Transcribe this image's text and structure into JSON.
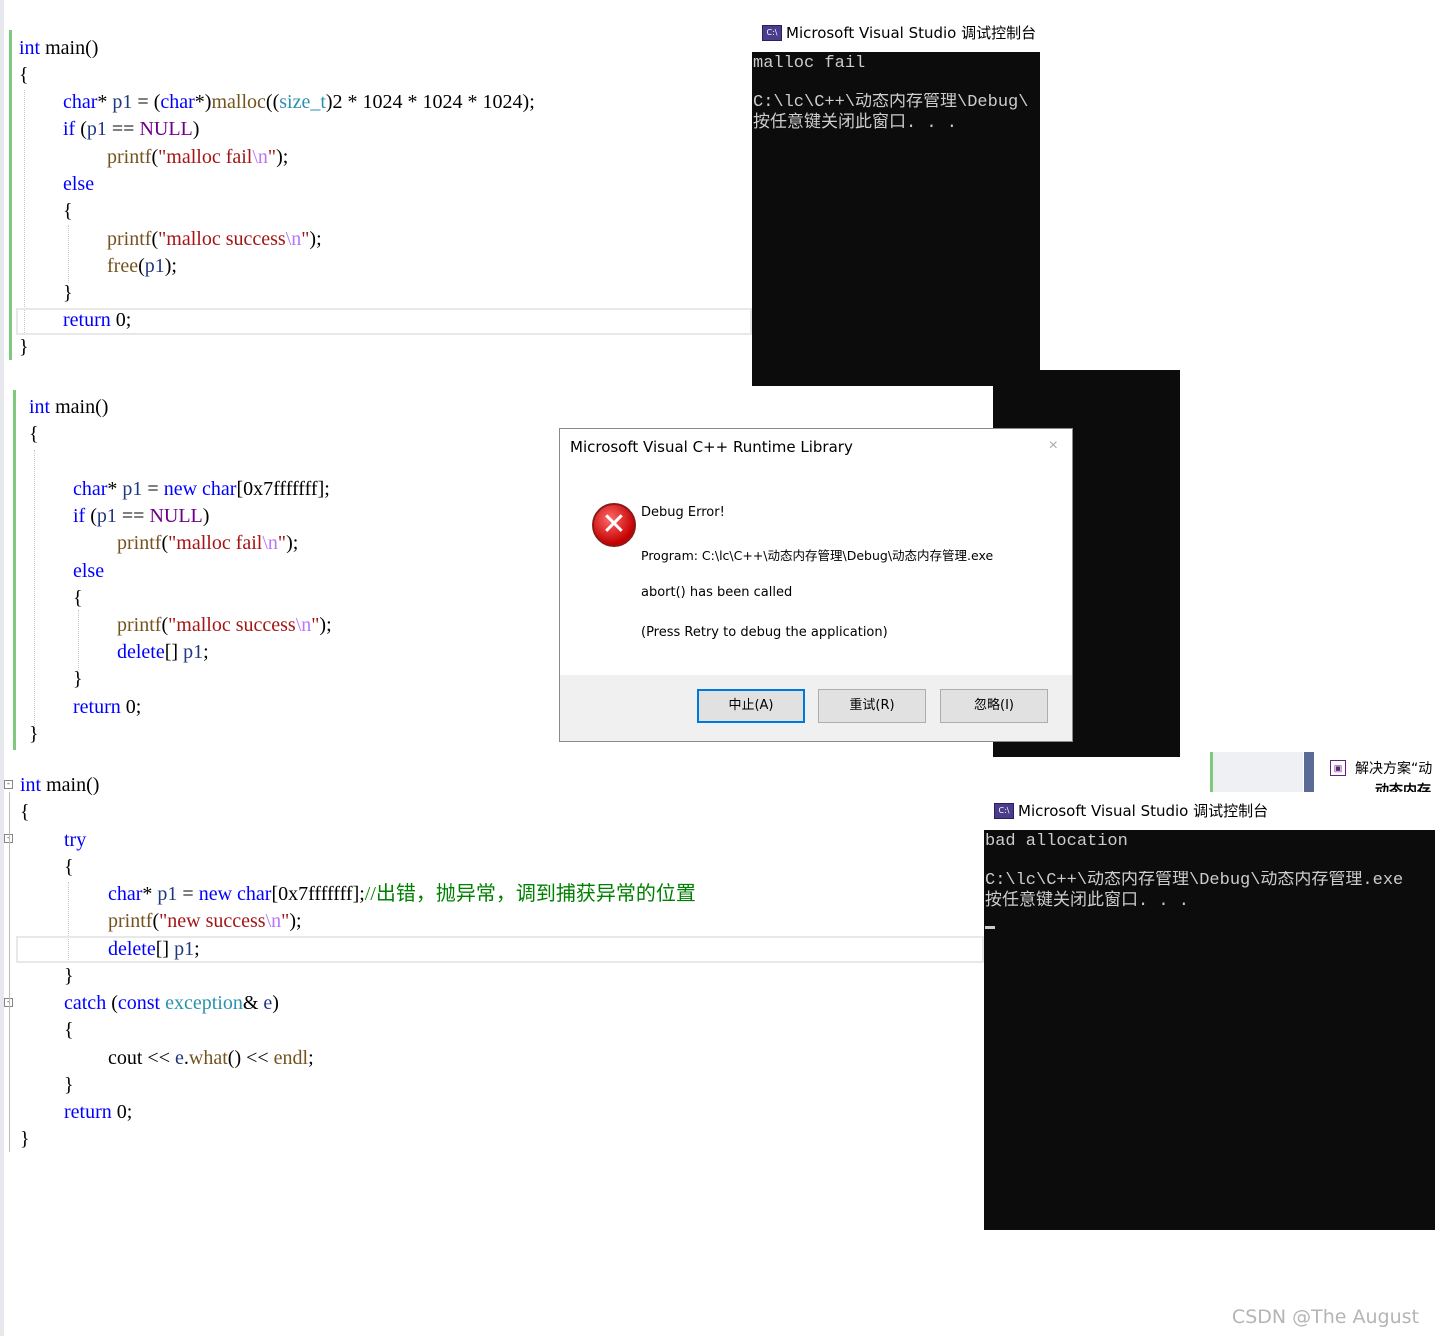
{
  "snippet1": {
    "lines": [
      {
        "parts": [
          {
            "c": "kw",
            "t": "int"
          },
          {
            "c": "",
            "t": " main()"
          }
        ]
      },
      {
        "parts": [
          {
            "c": "",
            "t": "{"
          }
        ]
      },
      {
        "parts": [
          {
            "c": "kw",
            "t": "char"
          },
          {
            "c": "",
            "t": "* "
          },
          {
            "c": "var",
            "t": "p1"
          },
          {
            "c": "",
            "t": " = ("
          },
          {
            "c": "kw",
            "t": "char"
          },
          {
            "c": "",
            "t": "*)"
          },
          {
            "c": "fn",
            "t": "malloc"
          },
          {
            "c": "",
            "t": "(("
          },
          {
            "c": "ty",
            "t": "size_t"
          },
          {
            "c": "",
            "t": ")2 * 1024 * 1024 * 1024);"
          }
        ]
      },
      {
        "parts": [
          {
            "c": "kw",
            "t": "if"
          },
          {
            "c": "",
            "t": " ("
          },
          {
            "c": "var",
            "t": "p1"
          },
          {
            "c": "",
            "t": " == "
          },
          {
            "c": "mac",
            "t": "NULL"
          },
          {
            "c": "",
            "t": ")"
          }
        ]
      },
      {
        "parts": [
          {
            "c": "fn",
            "t": "printf"
          },
          {
            "c": "",
            "t": "("
          },
          {
            "c": "str",
            "t": "\"malloc fail"
          },
          {
            "c": "esc",
            "t": "\\n"
          },
          {
            "c": "str",
            "t": "\""
          },
          {
            "c": "",
            "t": ");"
          }
        ]
      },
      {
        "parts": [
          {
            "c": "kw",
            "t": "else"
          }
        ]
      },
      {
        "parts": [
          {
            "c": "",
            "t": "{"
          }
        ]
      },
      {
        "parts": [
          {
            "c": "fn",
            "t": "printf"
          },
          {
            "c": "",
            "t": "("
          },
          {
            "c": "str",
            "t": "\"malloc success"
          },
          {
            "c": "esc",
            "t": "\\n"
          },
          {
            "c": "str",
            "t": "\""
          },
          {
            "c": "",
            "t": ");"
          }
        ]
      },
      {
        "parts": [
          {
            "c": "fn",
            "t": "free"
          },
          {
            "c": "",
            "t": "("
          },
          {
            "c": "var",
            "t": "p1"
          },
          {
            "c": "",
            "t": ");"
          }
        ]
      },
      {
        "parts": [
          {
            "c": "",
            "t": "}"
          }
        ]
      },
      {
        "parts": [
          {
            "c": "kw",
            "t": "return"
          },
          {
            "c": "",
            "t": " 0;"
          }
        ]
      },
      {
        "parts": [
          {
            "c": "",
            "t": "}"
          }
        ]
      }
    ]
  },
  "snippet2": {
    "lines": [
      {
        "parts": [
          {
            "c": "kw",
            "t": "int"
          },
          {
            "c": "",
            "t": " main()"
          }
        ]
      },
      {
        "parts": [
          {
            "c": "",
            "t": "{"
          }
        ]
      },
      {
        "parts": [
          {
            "c": "kw",
            "t": "char"
          },
          {
            "c": "",
            "t": "* "
          },
          {
            "c": "var",
            "t": "p1"
          },
          {
            "c": "",
            "t": " = "
          },
          {
            "c": "kw",
            "t": "new"
          },
          {
            "c": "",
            "t": " "
          },
          {
            "c": "kw",
            "t": "char"
          },
          {
            "c": "",
            "t": "[0x7fffffff];"
          }
        ]
      },
      {
        "parts": [
          {
            "c": "kw",
            "t": "if"
          },
          {
            "c": "",
            "t": " ("
          },
          {
            "c": "var",
            "t": "p1"
          },
          {
            "c": "",
            "t": " == "
          },
          {
            "c": "mac",
            "t": "NULL"
          },
          {
            "c": "",
            "t": ")"
          }
        ]
      },
      {
        "parts": [
          {
            "c": "fn",
            "t": "printf"
          },
          {
            "c": "",
            "t": "("
          },
          {
            "c": "str",
            "t": "\"malloc fail"
          },
          {
            "c": "esc",
            "t": "\\n"
          },
          {
            "c": "str",
            "t": "\""
          },
          {
            "c": "",
            "t": ");"
          }
        ]
      },
      {
        "parts": [
          {
            "c": "kw",
            "t": "else"
          }
        ]
      },
      {
        "parts": [
          {
            "c": "",
            "t": "{"
          }
        ]
      },
      {
        "parts": [
          {
            "c": "fn",
            "t": "printf"
          },
          {
            "c": "",
            "t": "("
          },
          {
            "c": "str",
            "t": "\"malloc success"
          },
          {
            "c": "esc",
            "t": "\\n"
          },
          {
            "c": "str",
            "t": "\""
          },
          {
            "c": "",
            "t": ");"
          }
        ]
      },
      {
        "parts": [
          {
            "c": "kw",
            "t": "delete"
          },
          {
            "c": "",
            "t": "[] "
          },
          {
            "c": "var",
            "t": "p1"
          },
          {
            "c": "",
            "t": ";"
          }
        ]
      },
      {
        "parts": [
          {
            "c": "",
            "t": "}"
          }
        ]
      },
      {
        "parts": [
          {
            "c": "kw",
            "t": "return"
          },
          {
            "c": "",
            "t": " 0;"
          }
        ]
      },
      {
        "parts": [
          {
            "c": "",
            "t": "}"
          }
        ]
      }
    ]
  },
  "snippet3": {
    "lines": [
      {
        "parts": [
          {
            "c": "kw",
            "t": "int"
          },
          {
            "c": "",
            "t": " main()"
          }
        ]
      },
      {
        "parts": [
          {
            "c": "",
            "t": "{"
          }
        ]
      },
      {
        "parts": [
          {
            "c": "kw",
            "t": "try"
          }
        ]
      },
      {
        "parts": [
          {
            "c": "",
            "t": "{"
          }
        ]
      },
      {
        "parts": [
          {
            "c": "kw",
            "t": "char"
          },
          {
            "c": "",
            "t": "* "
          },
          {
            "c": "var",
            "t": "p1"
          },
          {
            "c": "",
            "t": " = "
          },
          {
            "c": "kw",
            "t": "new"
          },
          {
            "c": "",
            "t": " "
          },
          {
            "c": "kw",
            "t": "char"
          },
          {
            "c": "",
            "t": "[0x7fffffff];"
          },
          {
            "c": "cm",
            "t": "//出错，抛异常，调到捕获异常的位置"
          }
        ]
      },
      {
        "parts": [
          {
            "c": "fn",
            "t": "printf"
          },
          {
            "c": "",
            "t": "("
          },
          {
            "c": "str",
            "t": "\"new success"
          },
          {
            "c": "esc",
            "t": "\\n"
          },
          {
            "c": "str",
            "t": "\""
          },
          {
            "c": "",
            "t": ");"
          }
        ]
      },
      {
        "parts": [
          {
            "c": "kw",
            "t": "delete"
          },
          {
            "c": "",
            "t": "[] "
          },
          {
            "c": "var",
            "t": "p1"
          },
          {
            "c": "",
            "t": ";"
          }
        ]
      },
      {
        "parts": [
          {
            "c": "",
            "t": "}"
          }
        ]
      },
      {
        "parts": [
          {
            "c": "kw",
            "t": "catch"
          },
          {
            "c": "",
            "t": " ("
          },
          {
            "c": "kw",
            "t": "const"
          },
          {
            "c": "",
            "t": " "
          },
          {
            "c": "ty",
            "t": "exception"
          },
          {
            "c": "",
            "t": "& "
          },
          {
            "c": "var",
            "t": "e"
          },
          {
            "c": "",
            "t": ")"
          }
        ]
      },
      {
        "parts": [
          {
            "c": "",
            "t": "{"
          }
        ]
      },
      {
        "parts": [
          {
            "c": "",
            "t": "cout << "
          },
          {
            "c": "var",
            "t": "e"
          },
          {
            "c": "",
            "t": "."
          },
          {
            "c": "fn",
            "t": "what"
          },
          {
            "c": "",
            "t": "() << "
          },
          {
            "c": "fn",
            "t": "endl"
          },
          {
            "c": "",
            "t": ";"
          }
        ]
      },
      {
        "parts": [
          {
            "c": "",
            "t": "}"
          }
        ]
      },
      {
        "parts": [
          {
            "c": "kw",
            "t": "return"
          },
          {
            "c": "",
            "t": " 0;"
          }
        ]
      },
      {
        "parts": [
          {
            "c": "",
            "t": "}"
          }
        ]
      }
    ]
  },
  "console1": {
    "title": "Microsoft Visual Studio 调试控制台",
    "icon": "C:\\",
    "output_line1": "malloc fail",
    "output_line2": "C:\\lc\\C++\\动态内存管理\\Debug\\",
    "output_line3": "按任意键关闭此窗口. . ."
  },
  "dialog": {
    "title": "Microsoft Visual C++ Runtime Library",
    "close": "×",
    "heading": "Debug Error!",
    "program": "Program: C:\\lc\\C++\\动态内存管理\\Debug\\动态内存管理.exe",
    "message": "abort() has been called",
    "hint": "(Press Retry to debug the application)",
    "icon_glyph": "✕",
    "buttons": {
      "abort": "中止(A)",
      "retry": "重试(R)",
      "ignore": "忽略(I)"
    }
  },
  "console3": {
    "title": "Microsoft Visual Studio 调试控制台",
    "icon": "C:\\",
    "output_line1": "bad allocation",
    "output_line2": "C:\\lc\\C++\\动态内存管理\\Debug\\动态内存管理.exe",
    "output_line3": "按任意键关闭此窗口. . ."
  },
  "solution_panel": {
    "label1": "解决方案“动",
    "label2": "动态内存"
  },
  "watermark": "CSDN @The   August"
}
